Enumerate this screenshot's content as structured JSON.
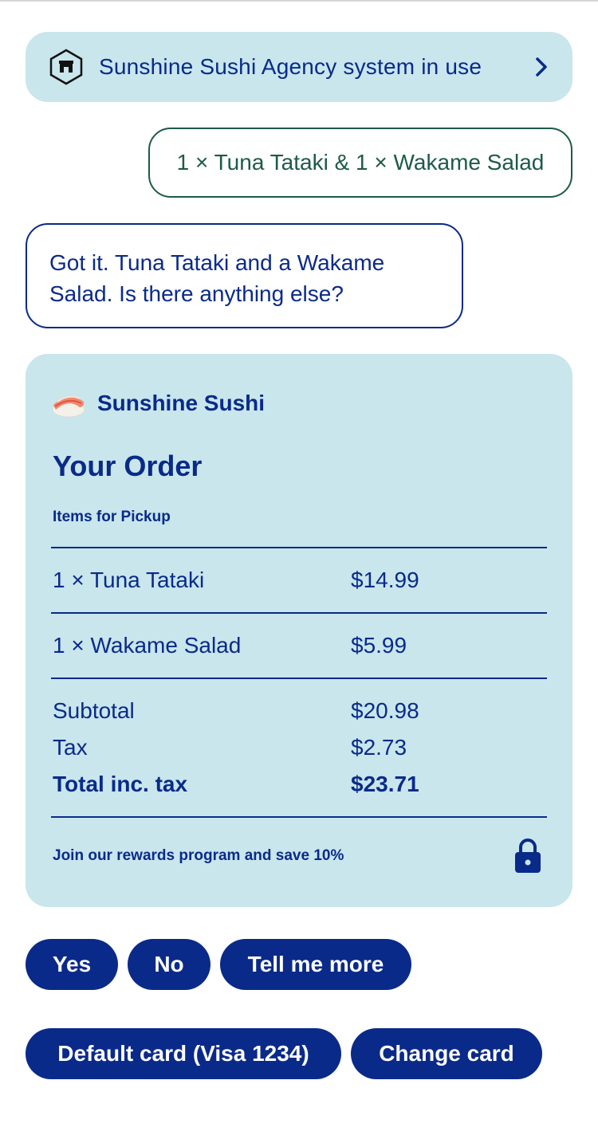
{
  "banner": {
    "text": "Sunshine Sushi Agency system in use",
    "icon": "store-hexagon-icon",
    "chevron": "chevron-right-icon"
  },
  "messages": {
    "user": "1 × Tuna Tataki & 1 × Wakame Salad",
    "bot": "Got it. Tuna Tataki and a Wakame Salad. Is there anything else?"
  },
  "order": {
    "brand": "Sunshine Sushi",
    "title": "Your Order",
    "section_label": "Items for Pickup",
    "items": [
      {
        "label": "1 × Tuna Tataki",
        "price": "$14.99"
      },
      {
        "label": "1 × Wakame Salad",
        "price": "$5.99"
      }
    ],
    "subtotal_label": "Subtotal",
    "subtotal": "$20.98",
    "tax_label": "Tax",
    "tax": "$2.73",
    "total_label": "Total inc. tax",
    "total": "$23.71",
    "rewards": "Join our rewards program and save 10%"
  },
  "quick_replies": [
    "Yes",
    "No",
    "Tell me more"
  ],
  "payment": {
    "default_card": "Default card (Visa 1234)",
    "change_card": "Change card"
  },
  "colors": {
    "primary": "#0a2a8a",
    "card_bg": "#c8e6ec",
    "user_bubble": "#1d5a4a"
  }
}
